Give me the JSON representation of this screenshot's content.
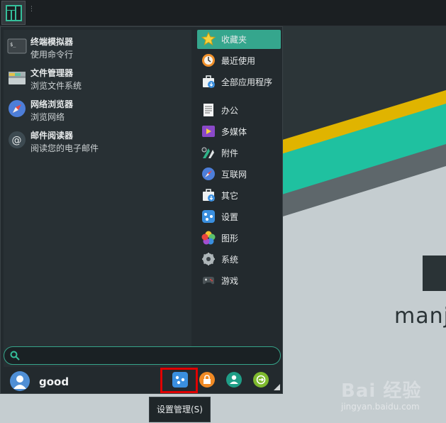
{
  "desktop": {
    "wallpaper_text": "manj",
    "watermark_brand": "Bai 经验",
    "watermark_url": "jingyan.baidu.com"
  },
  "menu": {
    "favorites": [
      {
        "title": "终端模拟器",
        "desc": "使用命令行",
        "icon": "terminal-icon"
      },
      {
        "title": "文件管理器",
        "desc": "浏览文件系统",
        "icon": "folder-icon"
      },
      {
        "title": "网络浏览器",
        "desc": "浏览网络",
        "icon": "compass-icon"
      },
      {
        "title": "邮件阅读器",
        "desc": "阅读您的电子邮件",
        "icon": "mail-icon"
      }
    ],
    "categories": [
      {
        "label": "收藏夹",
        "icon": "star-icon",
        "active": true
      },
      {
        "label": "最近使用",
        "icon": "recent-icon"
      },
      {
        "label": "全部应用程序",
        "icon": "all-apps-icon"
      },
      {
        "label": "办公",
        "icon": "office-icon"
      },
      {
        "label": "多媒体",
        "icon": "multimedia-icon"
      },
      {
        "label": "附件",
        "icon": "accessories-icon"
      },
      {
        "label": "互联网",
        "icon": "internet-icon"
      },
      {
        "label": "其它",
        "icon": "other-icon"
      },
      {
        "label": "设置",
        "icon": "settings-icon"
      },
      {
        "label": "图形",
        "icon": "graphics-icon"
      },
      {
        "label": "系统",
        "icon": "system-icon"
      },
      {
        "label": "游戏",
        "icon": "games-icon"
      }
    ],
    "search": {
      "value": "",
      "placeholder": ""
    },
    "user": {
      "name": "good"
    },
    "tooltip": "设置管理(S)"
  },
  "colors": {
    "accent": "#35a68d",
    "highlight": "#e00000",
    "panel": "#1b1f22",
    "menu_bg": "#232a2e"
  }
}
